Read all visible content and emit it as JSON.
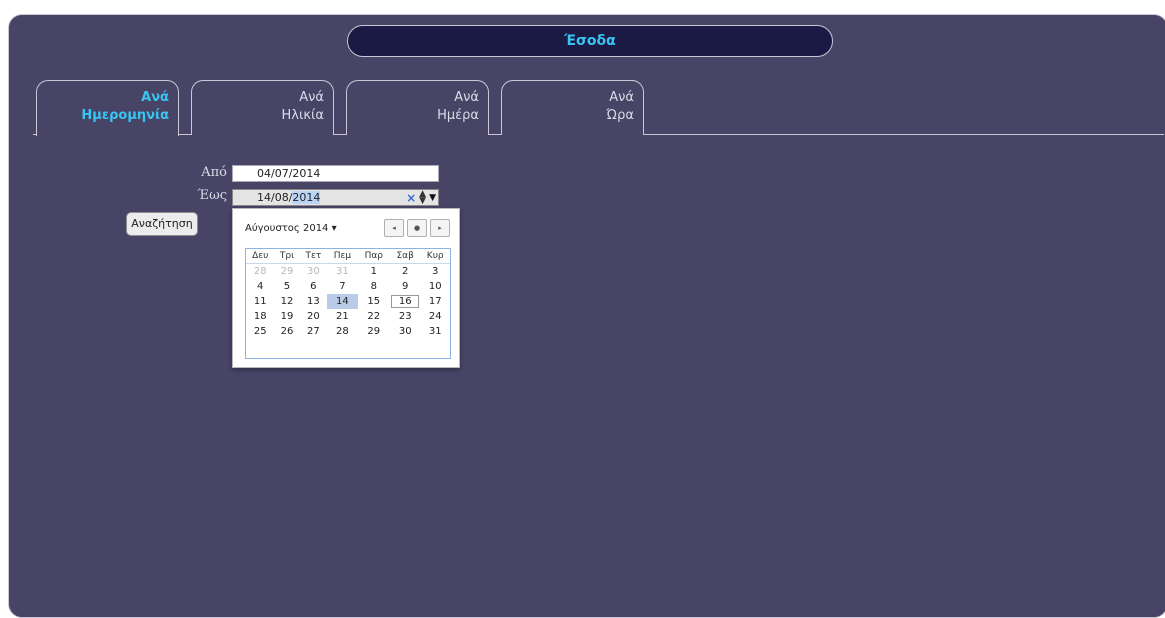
{
  "header": {
    "title": "Έσοδα"
  },
  "tabs": [
    {
      "line1": "Ανά",
      "line2": "Ημερομηνία",
      "active": true
    },
    {
      "line1": "Ανά",
      "line2": "Ηλικία",
      "active": false
    },
    {
      "line1": "Ανά",
      "line2": "Ημέρα",
      "active": false
    },
    {
      "line1": "Ανά",
      "line2": "Ώρα",
      "active": false
    }
  ],
  "form": {
    "from_label": "Από",
    "from_value": "04/07/2014",
    "to_label": "Έως",
    "to_value_prefix": "14/08/",
    "to_value_selected": "2014",
    "search_label": "Αναζήτηση"
  },
  "datepicker": {
    "month_label": "Αύγουστος 2014",
    "weekdays": [
      "Δευ",
      "Τρι",
      "Τετ",
      "Πεμ",
      "Παρ",
      "Σαβ",
      "Κυρ"
    ],
    "weeks": [
      [
        "28",
        "29",
        "30",
        "31",
        "1",
        "2",
        "3"
      ],
      [
        "4",
        "5",
        "6",
        "7",
        "8",
        "9",
        "10"
      ],
      [
        "11",
        "12",
        "13",
        "14",
        "15",
        "16",
        "17"
      ],
      [
        "18",
        "19",
        "20",
        "21",
        "22",
        "23",
        "24"
      ],
      [
        "25",
        "26",
        "27",
        "28",
        "29",
        "30",
        "31"
      ]
    ],
    "outside_month": [
      "0-0",
      "0-1",
      "0-2",
      "0-3"
    ],
    "selected": "2-3",
    "today": "2-5"
  },
  "icons": {
    "clear": "clear-icon",
    "spinner": "spinner-icon",
    "dropdown": "dropdown-arrow-icon"
  }
}
